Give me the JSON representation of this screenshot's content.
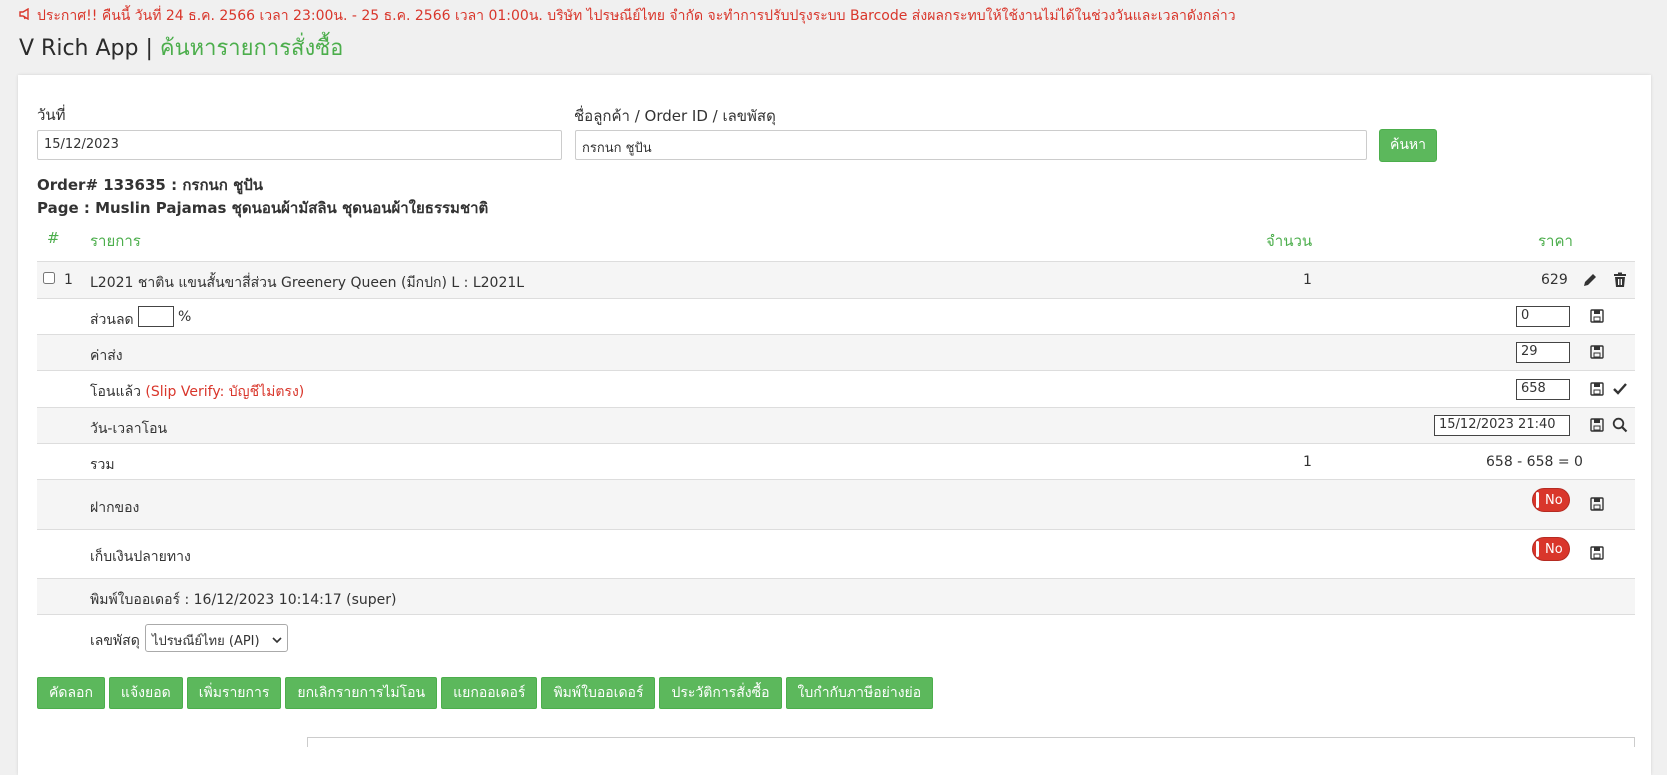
{
  "announcement": "ประกาศ!! คืนนี้ วันที่ 24 ธ.ค. 2566 เวลา 23:00น. - 25 ธ.ค. 2566 เวลา 01:00น. บริษัท ไปรษณีย์ไทย จำกัด จะทำการปรับปรุงระบบ Barcode ส่งผลกระทบให้ใช้งานไม่ได้ในช่วงวันและเวลาดังกล่าว",
  "app": {
    "name": "V Rich App |",
    "page_title": "ค้นหารายการสั่งซื้อ"
  },
  "search": {
    "date_label": "วันที่",
    "date_value": "15/12/2023",
    "customer_label": "ชื่อลูกค้า / Order ID / เลขพัสดุ",
    "customer_value": "กรกนก ชูปัน",
    "search_button": "ค้นหา"
  },
  "order": {
    "title": "Order# 133635 : กรกนก ชูปัน",
    "page": "Page : Muslin Pajamas ชุดนอนผ้ามัสลิน ชุดนอนผ้าใยธรรมชาติ"
  },
  "table": {
    "headers": {
      "num": "#",
      "item": "รายการ",
      "qty": "จำนวน",
      "price": "ราคา"
    },
    "item": {
      "index": "1",
      "name": "L2021 ชาติน แขนสั้นขาสี่ส่วน Greenery Queen (มีกปก) L : L2021L",
      "qty": "1",
      "price": "629"
    },
    "discount": {
      "label": "ส่วนลด",
      "percent_symbol": "%",
      "value": "0"
    },
    "shipping": {
      "label": "ค่าส่ง",
      "value": "29"
    },
    "paid": {
      "label": "โอนแล้ว",
      "note": "(Slip Verify: บัญชีไม่ตรง)",
      "value": "658"
    },
    "transfer_time": {
      "label": "วัน-เวลาโอน",
      "value": "15/12/2023 21:40"
    },
    "total": {
      "label": "รวม",
      "qty": "1",
      "summary": "658 - 658 = 0"
    },
    "deposit": {
      "label": "ฝากของ",
      "toggle": "No"
    },
    "cod": {
      "label": "เก็บเงินปลายทาง",
      "toggle": "No"
    },
    "printed": "พิมพ์ใบออเดอร์ : 16/12/2023 10:14:17 (super)",
    "tracking": {
      "label": "เลขพัสดุ",
      "selected": "ไปรษณีย์ไทย (API)"
    }
  },
  "actions": [
    "คัดลอก",
    "แจ้งยอด",
    "เพิ่มรายการ",
    "ยกเลิกรายการไม่โอน",
    "แยกออเดอร์",
    "พิมพ์ใบออเดอร์",
    "ประวัติการสั่งซื้อ",
    "ใบกำกับภาษีอย่างย่อ"
  ],
  "colors": {
    "accent_green": "#5cb85c",
    "alert_red": "#d9362b"
  }
}
